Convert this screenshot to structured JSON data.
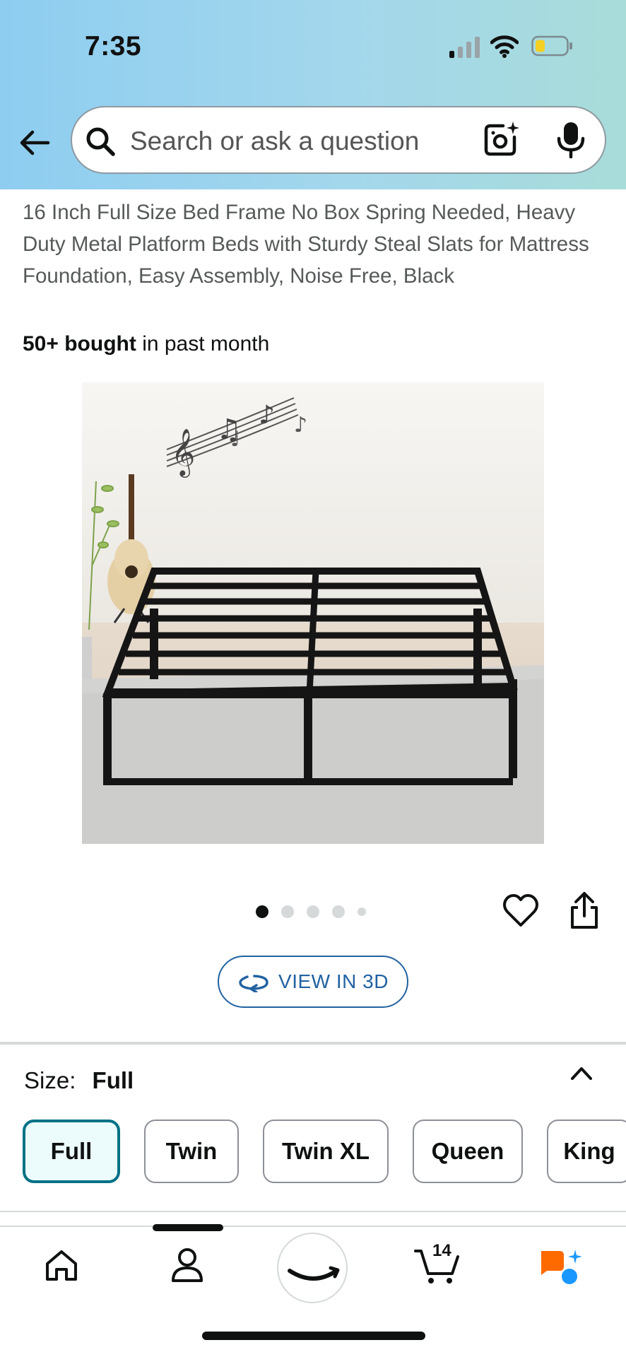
{
  "status_bar": {
    "time": "7:35"
  },
  "search": {
    "placeholder": "Search or ask a question"
  },
  "product": {
    "title": "16 Inch Full Size Bed Frame No Box Spring Needed, Heavy Duty Metal Platform Beds with Sturdy Steal Slats for Mattress Foundation, Easy Assembly, Noise Free, Black",
    "bought_count": "50+ bought",
    "bought_suffix": "in past month"
  },
  "carousel": {
    "image_count": 5,
    "active_index": 0
  },
  "view3d": {
    "label": "VIEW IN 3D"
  },
  "size": {
    "label": "Size:",
    "selected": "Full",
    "options": [
      "Full",
      "Twin",
      "Twin XL",
      "Queen",
      "King"
    ]
  },
  "nav": {
    "items": [
      "home-icon",
      "user-icon",
      "amazon-smile-icon",
      "cart-icon",
      "rufus-icon"
    ],
    "cart_count": "14"
  },
  "colors": {
    "accent": "#007185",
    "link": "#2162a1",
    "header_start": "#8ecdf0",
    "header_end": "#a8dcd9"
  }
}
